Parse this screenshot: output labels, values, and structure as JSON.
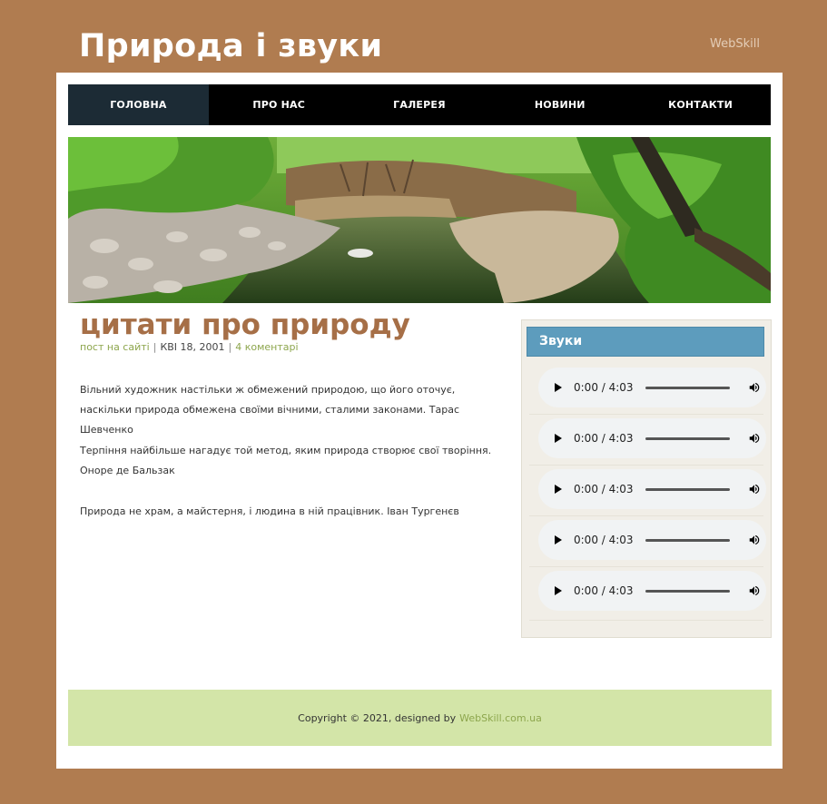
{
  "header": {
    "site_title": "Природа і звуки",
    "brand_link": "WebSkill"
  },
  "nav": {
    "items": [
      {
        "label": "ГОЛОВНА",
        "active": true
      },
      {
        "label": "ПРО НАС",
        "active": false
      },
      {
        "label": "ГАЛЕРЕЯ",
        "active": false
      },
      {
        "label": "НОВИНИ",
        "active": false
      },
      {
        "label": "КОНТАКТИ",
        "active": false
      }
    ]
  },
  "post": {
    "title": "цитати про природу",
    "meta": {
      "author_link": "пост на сайті",
      "separator": "|",
      "date": "КВІ 18, 2001",
      "comments_link": "4 коментарі"
    },
    "quotes": [
      "Вільний художник настільки ж обмежений природою, що його оточує, наскільки природа обмежена своїми вічними, сталими законами. Тарас Шевченко",
      "Терпіння найбільше нагадує той метод, яким природа створює свої творіння. Оноре де Бальзак",
      "Природа не храм, а майстерня, і людина в ній працівник. Іван Тургенєв"
    ]
  },
  "sidebar": {
    "title": "Звуки",
    "players": [
      {
        "time": "0:00 / 4:03"
      },
      {
        "time": "0:00 / 4:03"
      },
      {
        "time": "0:00 / 4:03"
      },
      {
        "time": "0:00 / 4:03"
      },
      {
        "time": "0:00 / 4:03"
      }
    ]
  },
  "footer": {
    "copyright": "Copyright © 2021, designed by",
    "link": "WebSkill.com.ua"
  },
  "colors": {
    "page_bg": "#b07c50",
    "nav_active": "#1c2b35",
    "title_brown": "#a66f47",
    "link_green": "#8da64d",
    "sidebar_header": "#5d9cbd",
    "footer_bg": "#d3e5a8"
  }
}
